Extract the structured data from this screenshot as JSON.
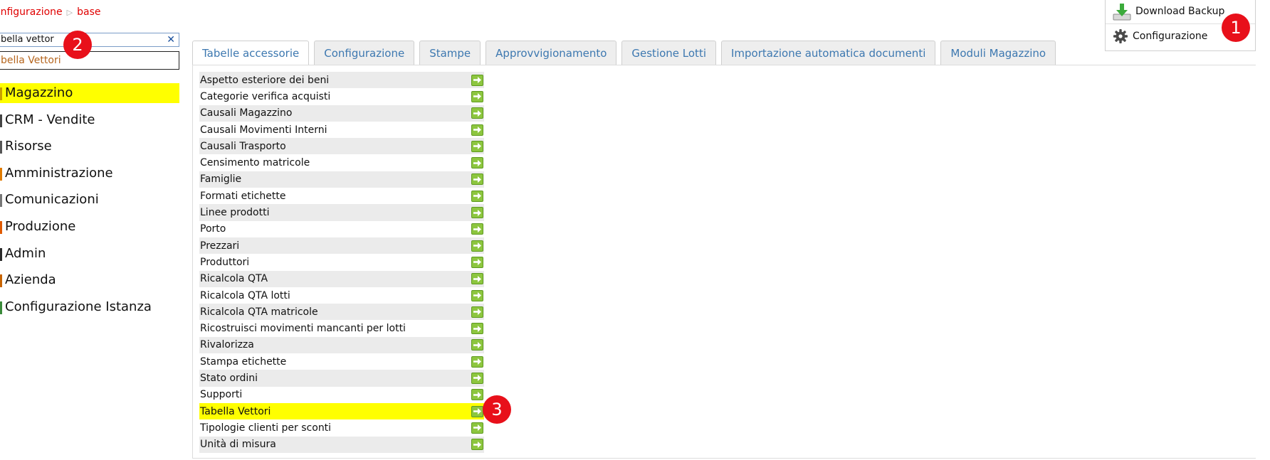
{
  "breadcrumb": {
    "parent": "onfigurazione",
    "current": "base"
  },
  "search": {
    "value": "bella vettor"
  },
  "suggestion": {
    "label": "bella Vettori"
  },
  "sidebar": {
    "items": [
      {
        "label": "Magazzino",
        "marker": "#c8a000"
      },
      {
        "label": "CRM - Vendite",
        "marker": "#444444"
      },
      {
        "label": "Risorse",
        "marker": "#555555"
      },
      {
        "label": "Amministrazione",
        "marker": "#e07b00"
      },
      {
        "label": "Comunicazioni",
        "marker": "#777777"
      },
      {
        "label": "Produzione",
        "marker": "#e05a00"
      },
      {
        "label": "Admin",
        "marker": "#2a2a2a"
      },
      {
        "label": "Azienda",
        "marker": "#c86400"
      },
      {
        "label": "Configurazione Istanza",
        "marker": "#3a8a3a"
      }
    ]
  },
  "toolbar": {
    "download_label": "Download Backup",
    "config_label": "Configurazione"
  },
  "badges": [
    "1",
    "2",
    "3"
  ],
  "tabs": [
    {
      "label": "Tabelle accessorie"
    },
    {
      "label": "Configurazione"
    },
    {
      "label": "Stampe"
    },
    {
      "label": "Approvvigionamento"
    },
    {
      "label": "Gestione Lotti"
    },
    {
      "label": "Importazione automatica documenti"
    },
    {
      "label": "Moduli Magazzino"
    }
  ],
  "rows": [
    "Aspetto esteriore dei beni",
    "Categorie verifica acquisti",
    "Causali Magazzino",
    "Causali Movimenti Interni",
    "Causali Trasporto",
    "Censimento matricole",
    "Famiglie",
    "Formati etichette",
    "Linee prodotti",
    "Porto",
    "Prezzari",
    "Produttori",
    "Ricalcola QTA",
    "Ricalcola QTA lotti",
    "Ricalcola QTA matricole",
    "Ricostruisci movimenti mancanti per lotti",
    "Rivalorizza",
    "Stampa etichette",
    "Stato ordini",
    "Supporti",
    "Tabella Vettori",
    "Tipologie clienti per sconti",
    "Unità di misura"
  ],
  "colors": {
    "highlight": "#ffff00",
    "accent_red": "#e8101a",
    "tab_text": "#3d78b0",
    "go_green": "#8dc63f"
  }
}
